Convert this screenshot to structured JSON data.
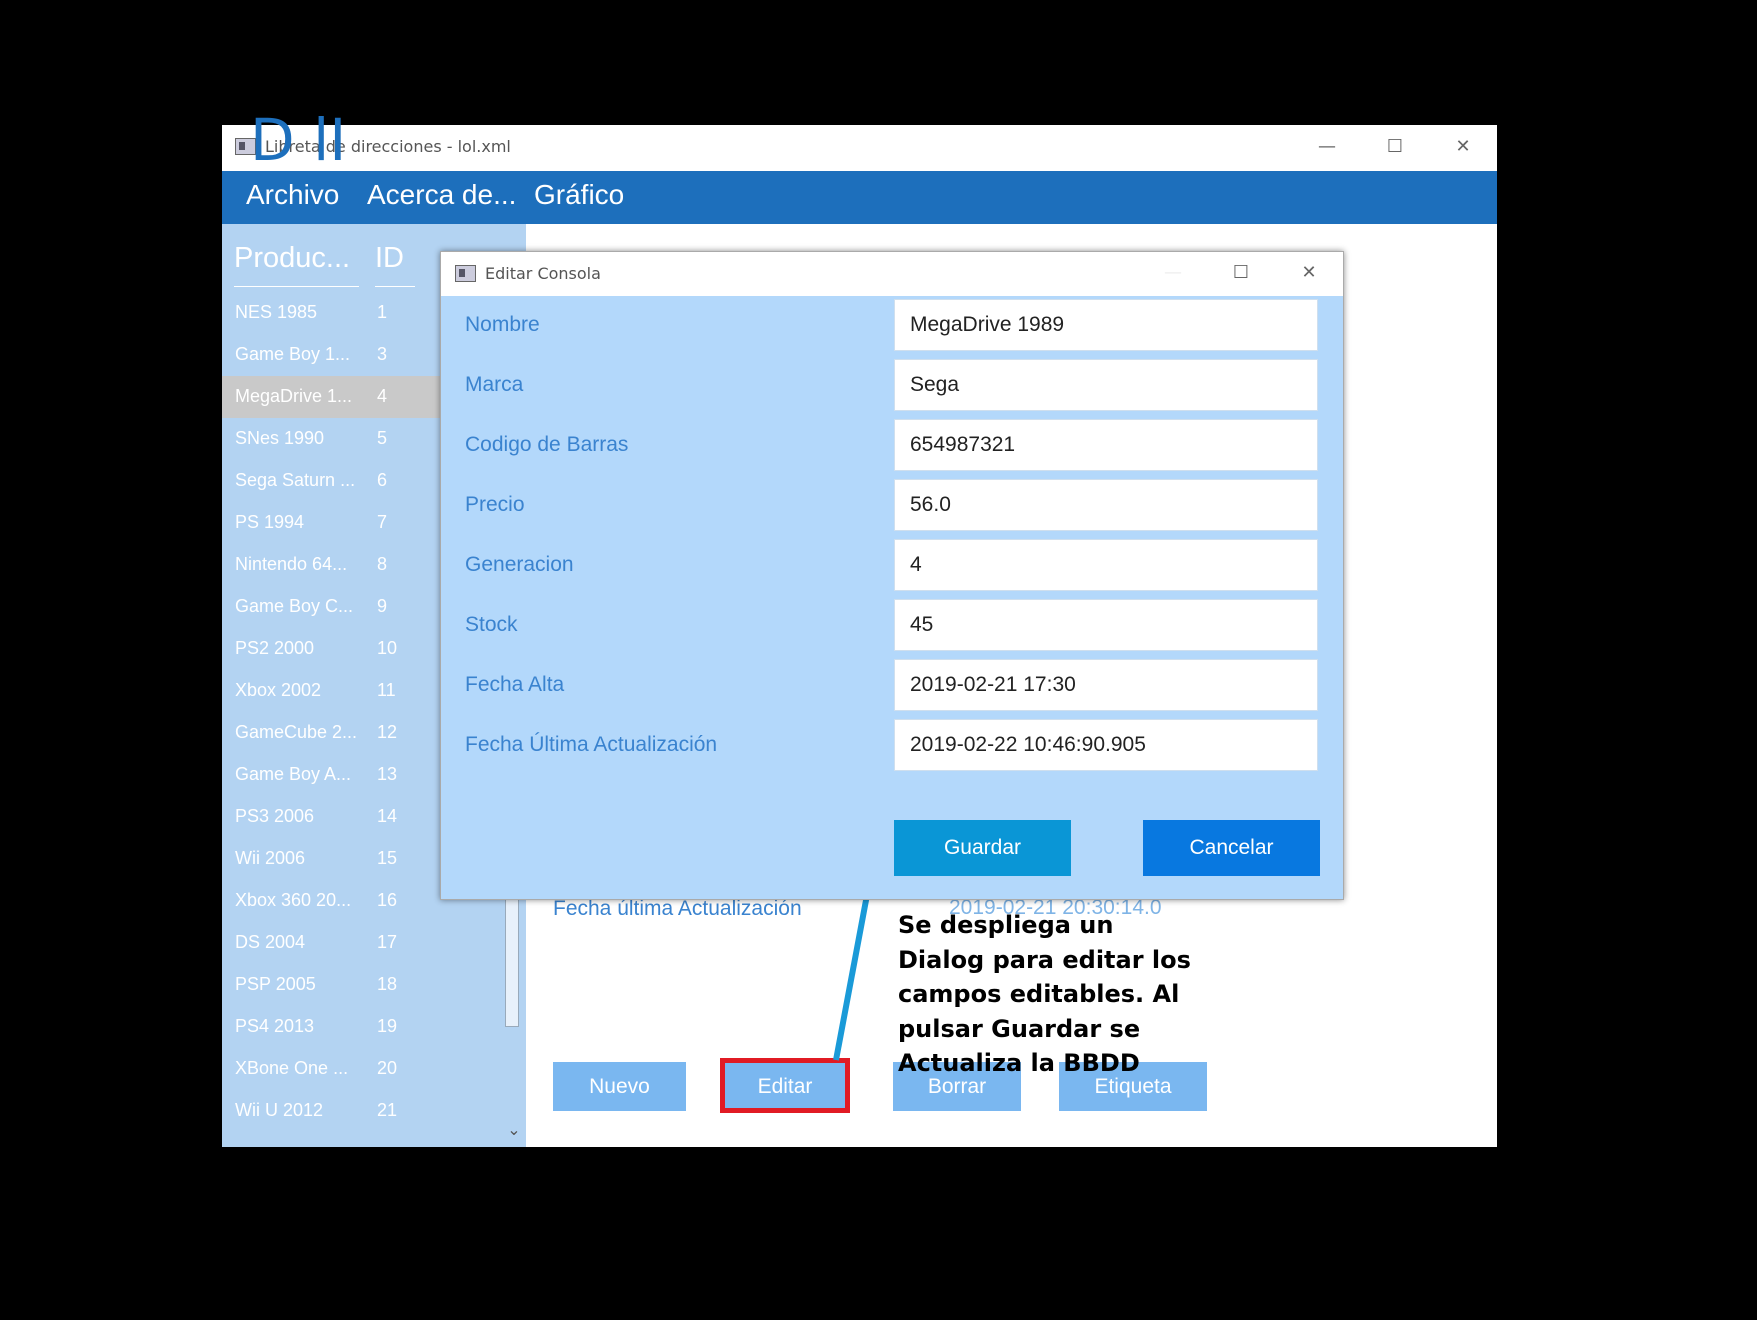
{
  "window": {
    "title": "Libreta de direcciones - lol.xml",
    "minimize": "—",
    "maximize": "☐",
    "close": "✕"
  },
  "menu": [
    "Archivo",
    "Acerca de...",
    "Gráfico"
  ],
  "table": {
    "headers": [
      "Produc...",
      "ID"
    ],
    "rows": [
      [
        "NES 1985",
        "1"
      ],
      [
        "Game Boy 1...",
        "3"
      ],
      [
        "MegaDrive 1...",
        "4"
      ],
      [
        "SNes 1990",
        "5"
      ],
      [
        "Sega Saturn ...",
        "6"
      ],
      [
        "PS 1994",
        "7"
      ],
      [
        "Nintendo 64...",
        "8"
      ],
      [
        "Game Boy C...",
        "9"
      ],
      [
        "PS2 2000",
        "10"
      ],
      [
        "Xbox 2002",
        "11"
      ],
      [
        "GameCube 2...",
        "12"
      ],
      [
        "Game Boy A...",
        "13"
      ],
      [
        "PS3 2006",
        "14"
      ],
      [
        "Wii 2006",
        "15"
      ],
      [
        "Xbox 360 20...",
        "16"
      ],
      [
        "DS 2004",
        "17"
      ],
      [
        "PSP 2005",
        "18"
      ],
      [
        "PS4 2013",
        "19"
      ],
      [
        "XBone One ...",
        "20"
      ],
      [
        "Wii U 2012",
        "21"
      ]
    ],
    "selected_index": 2
  },
  "background": {
    "title_fragment": "D    lI",
    "last_update_label": "Fecha última Actualización",
    "last_update_value": "2019-02-21 20:30:14.0",
    "buttons": [
      "Nuevo",
      "Editar",
      "Borrar",
      "Etiqueta"
    ]
  },
  "annotation": {
    "text": "Se despliega un Dialog para editar los campos editables. Al pulsar Guardar se Actualiza la BBDD",
    "highlight_color": "#e11b24",
    "connector_color": "#1a9ad8"
  },
  "dialog": {
    "title": "Editar Consola",
    "minimize": "—",
    "maximize": "☐",
    "close": "✕",
    "fields": [
      {
        "label": "Nombre",
        "value": "MegaDrive 1989"
      },
      {
        "label": "Marca",
        "value": "Sega"
      },
      {
        "label": "Codigo de Barras",
        "value": "654987321"
      },
      {
        "label": "Precio",
        "value": "56.0"
      },
      {
        "label": "Generacion",
        "value": "4"
      },
      {
        "label": "Stock",
        "value": "45"
      },
      {
        "label": "Fecha Alta",
        "value": "2019-02-21 17:30"
      },
      {
        "label": "Fecha Última Actualización",
        "value": "2019-02-22 10:46:90.905"
      }
    ],
    "save_label": "Guardar",
    "cancel_label": "Cancelar",
    "save_color": "#0a96d6",
    "cancel_color": "#0878e0"
  },
  "colors": {
    "menubar": "#1d6fbc",
    "panel": "#b3d3f2",
    "dialog_bg": "#b3d8fb",
    "label_text": "#3a83cf"
  }
}
